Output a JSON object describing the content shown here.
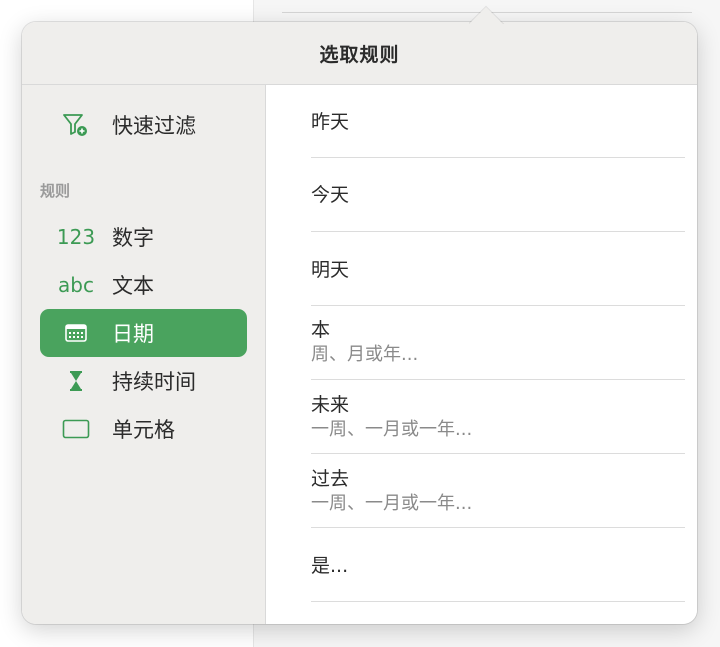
{
  "popover": {
    "title": "选取规则"
  },
  "sidebar": {
    "quick_filter": {
      "label": "快速过滤",
      "icon": "funnel-plus-icon"
    },
    "section_label": "规则",
    "items": [
      {
        "icon_text": "123",
        "label": "数字",
        "icon": "number-icon"
      },
      {
        "icon_text": "abc",
        "label": "文本",
        "icon": "text-icon"
      },
      {
        "label": "日期",
        "icon": "calendar-icon",
        "selected": true
      },
      {
        "label": "持续时间",
        "icon": "hourglass-icon"
      },
      {
        "label": "单元格",
        "icon": "cell-icon"
      }
    ]
  },
  "rules": [
    {
      "label": "昨天"
    },
    {
      "label": "今天"
    },
    {
      "label": "明天"
    },
    {
      "label": "本",
      "sub": "周、月或年..."
    },
    {
      "label": "未来",
      "sub": "一周、一月或一年..."
    },
    {
      "label": "过去",
      "sub": "一周、一月或一年..."
    },
    {
      "label": "是..."
    }
  ],
  "colors": {
    "accent": "#4aa35e",
    "icon": "#3c9a54",
    "panel": "#efeeec"
  }
}
